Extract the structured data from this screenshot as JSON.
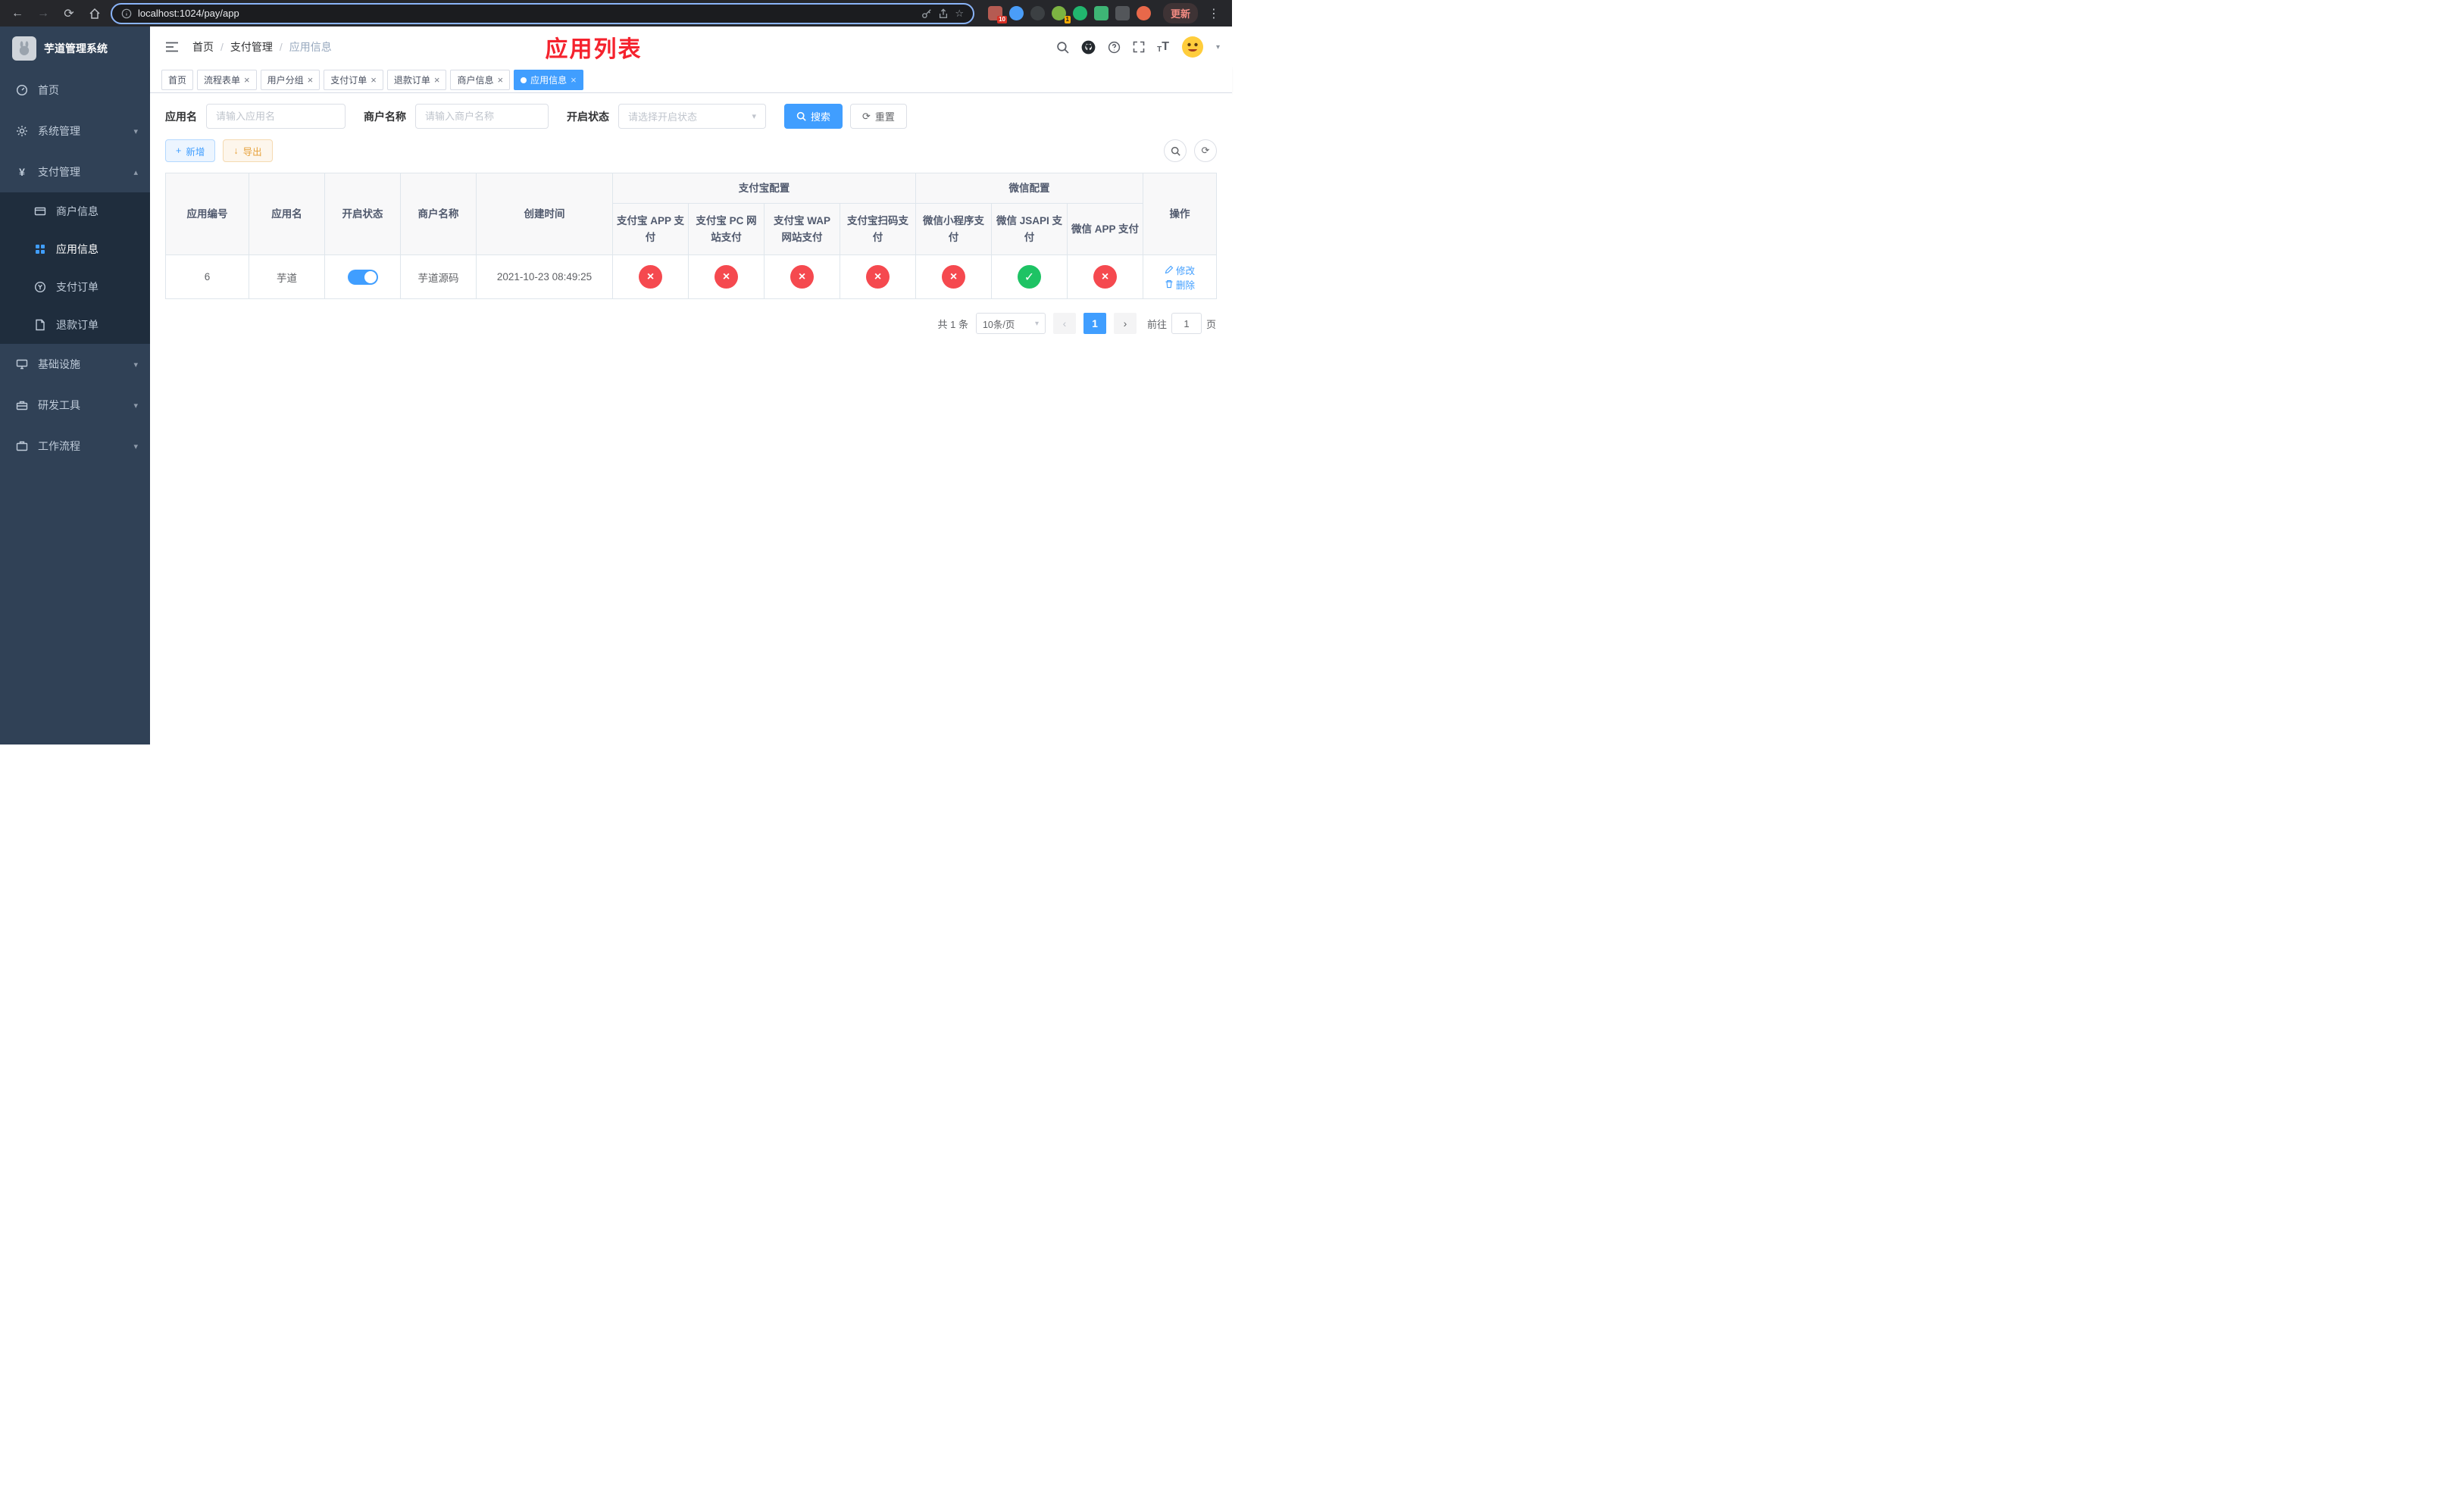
{
  "icons": {
    "back": "←",
    "forward": "→",
    "reload": "⟳",
    "home_glyph": "⌂",
    "star": "☆",
    "more": "⋮",
    "question": "?",
    "font_big": "T",
    "font_small": "T",
    "caret_down": "▾",
    "chevron_down": "▾",
    "chevron_up": "▴",
    "plus": "+",
    "download": "↓",
    "refresh": "⟳",
    "yen": "¥",
    "prev": "‹",
    "next": "›",
    "breadcrumb_sep": "/",
    "tab_close": "×"
  },
  "browser": {
    "url": "localhost:1024/pay/app",
    "update_label": "更新",
    "ext_badge_first": "10",
    "ext_badge_avatar": "1"
  },
  "sidebar": {
    "title": "芋道管理系统",
    "items": {
      "home": "首页",
      "system": "系统管理",
      "payment": "支付管理",
      "infra": "基础设施",
      "devtools": "研发工具",
      "workflow": "工作流程"
    },
    "payment_children": {
      "merchant": "商户信息",
      "app": "应用信息",
      "order": "支付订单",
      "refund": "退款订单"
    }
  },
  "navbar": {
    "breadcrumb": [
      "首页",
      "支付管理",
      "应用信息"
    ],
    "annotation": "应用列表"
  },
  "tabs": [
    {
      "label": "首页",
      "cls": "tag"
    },
    {
      "label": "流程表单",
      "cls": "tag"
    },
    {
      "label": "用户分组",
      "cls": "tag"
    },
    {
      "label": "支付订单",
      "cls": "tag"
    },
    {
      "label": "退款订单",
      "cls": "tag"
    },
    {
      "label": "商户信息",
      "cls": "tag"
    },
    {
      "label": "应用信息",
      "cls": "tag active"
    }
  ],
  "filters": {
    "app_name_label": "应用名",
    "app_name_placeholder": "请输入应用名",
    "merchant_label": "商户名称",
    "merchant_placeholder": "请输入商户名称",
    "status_label": "开启状态",
    "status_placeholder": "请选择开启状态",
    "search_label": "搜索",
    "reset_label": "重置"
  },
  "toolbar": {
    "add_label": "新增",
    "export_label": "导出"
  },
  "table": {
    "groups": {
      "alipay": "支付宝配置",
      "wechat": "微信配置"
    },
    "columns": {
      "id": "应用编号",
      "name": "应用名",
      "status": "开启状态",
      "merchant": "商户名称",
      "created": "创建时间",
      "alipay_app": "支付宝 APP 支付",
      "alipay_pc": "支付宝 PC 网站支付",
      "alipay_wap": "支付宝 WAP 网站支付",
      "alipay_qr": "支付宝扫码支付",
      "wx_mini": "微信小程序支付",
      "wx_jsapi": "微信 JSAPI 支付",
      "wx_app": "微信 APP 支付",
      "ops": "操作"
    },
    "rows": [
      {
        "id": "6",
        "name": "芋道",
        "switch_cls": "switch on",
        "merchant": "芋道源码",
        "created": "2021-10-23 08:49:25",
        "configs": [
          {
            "cls": "cfg fail",
            "glyph": "×"
          },
          {
            "cls": "cfg fail",
            "glyph": "×"
          },
          {
            "cls": "cfg fail",
            "glyph": "×"
          },
          {
            "cls": "cfg fail",
            "glyph": "×"
          },
          {
            "cls": "cfg fail",
            "glyph": "×"
          },
          {
            "cls": "cfg success",
            "glyph": "✓"
          },
          {
            "cls": "cfg fail",
            "glyph": "×"
          }
        ],
        "edit_label": "修改",
        "delete_label": "删除"
      }
    ]
  },
  "pagination": {
    "total": "共 1 条",
    "page_size": "10条/页",
    "current": "1",
    "goto_label": "前往",
    "goto_value": "1",
    "goto_suffix": "页"
  }
}
